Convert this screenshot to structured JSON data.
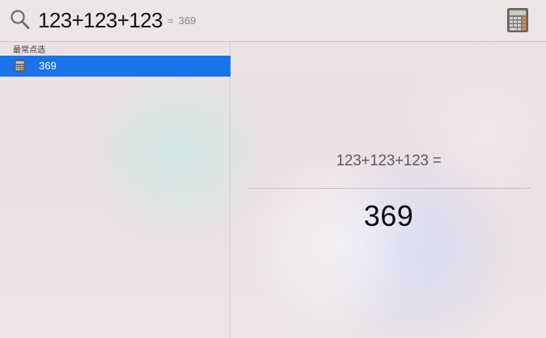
{
  "search": {
    "query": "123+123+123",
    "inline_result_equals": "=",
    "inline_result_value": "369",
    "icon": "search-icon",
    "app_icon": "calculator-icon"
  },
  "results": {
    "section_title": "最常点选",
    "items": [
      {
        "label": "369",
        "icon": "calculator-icon",
        "selected": true
      }
    ]
  },
  "preview": {
    "expression": "123+123+123 =",
    "result": "369"
  },
  "colors": {
    "selection": "#1a73e8",
    "query_text": "#111111",
    "secondary_text": "#8b8588"
  }
}
